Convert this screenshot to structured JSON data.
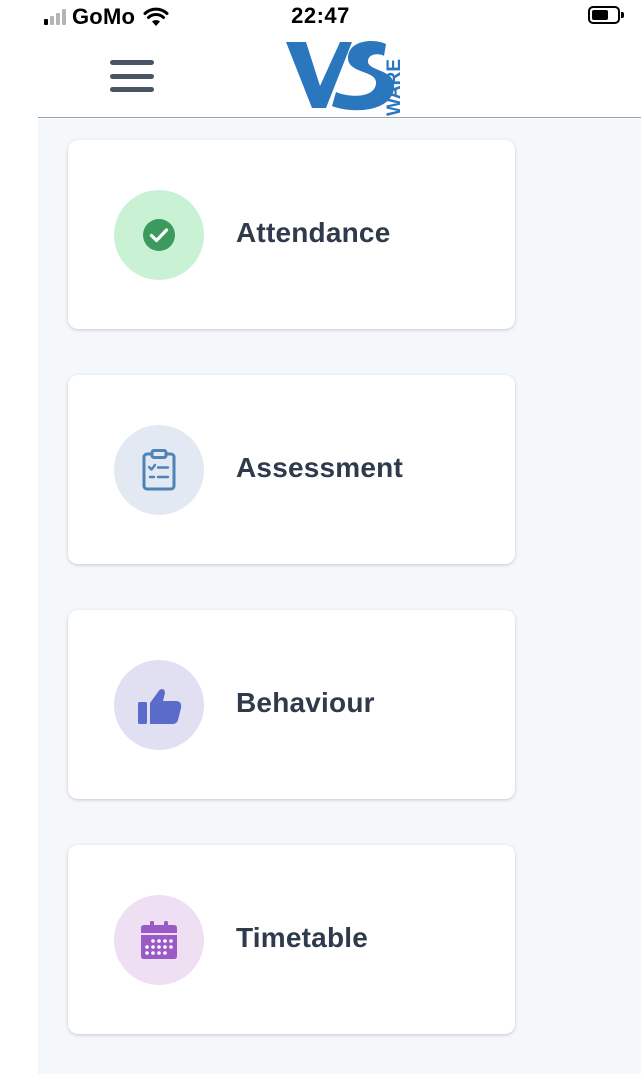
{
  "status_bar": {
    "carrier": "GoMo",
    "time": "22:47"
  },
  "header": {
    "logo_text_main": "VS",
    "logo_text_side": "WARE"
  },
  "menu": [
    {
      "label": "Attendance",
      "icon": "check-circle-icon",
      "color": "#3c9a5f",
      "bg": "#c9f2d5"
    },
    {
      "label": "Assessment",
      "icon": "clipboard-icon",
      "color": "#4f82b5",
      "bg": "#e2e9f2"
    },
    {
      "label": "Behaviour",
      "icon": "thumbs-up-icon",
      "color": "#5a6bc9",
      "bg": "#e0e0f2"
    },
    {
      "label": "Timetable",
      "icon": "calendar-icon",
      "color": "#9b5bc7",
      "bg": "#eedff3"
    }
  ]
}
